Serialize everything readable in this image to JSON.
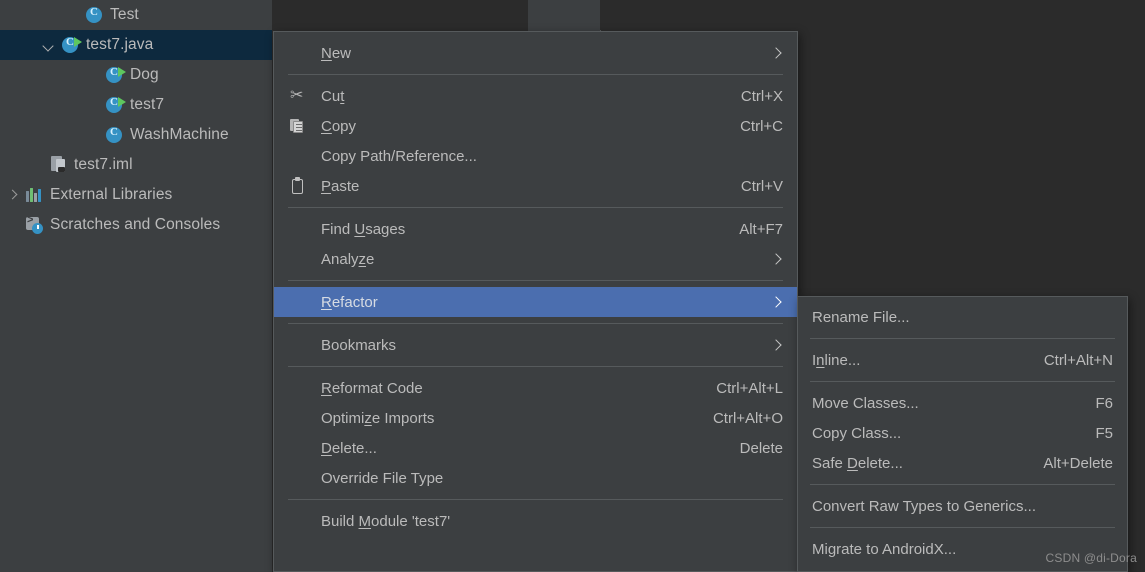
{
  "project_tree": {
    "items": [
      {
        "label": "Test",
        "icon": "java-class-icon",
        "indent": 84,
        "arrow": "none",
        "selected": false
      },
      {
        "label": "test7.java",
        "icon": "java-class-runnable-icon",
        "indent": 60,
        "arrow": "down",
        "selected": true
      },
      {
        "label": "Dog",
        "icon": "java-class-runnable-icon",
        "indent": 104,
        "arrow": "none",
        "selected": false
      },
      {
        "label": "test7",
        "icon": "java-class-runnable-icon",
        "indent": 104,
        "arrow": "none",
        "selected": false
      },
      {
        "label": "WashMachine",
        "icon": "java-class-icon",
        "indent": 104,
        "arrow": "none",
        "selected": false
      },
      {
        "label": "test7.iml",
        "icon": "module-file-icon",
        "indent": 48,
        "arrow": "none",
        "selected": false
      },
      {
        "label": "External Libraries",
        "icon": "libraries-icon",
        "indent": 24,
        "arrow": "right",
        "selected": false
      },
      {
        "label": "Scratches and Consoles",
        "icon": "scratches-icon",
        "indent": 24,
        "arrow": "none",
        "selected": false
      }
    ]
  },
  "context_menu": {
    "items": [
      {
        "type": "item",
        "name": "new",
        "label_pre": "",
        "label_mnemonic": "N",
        "label_post": "ew",
        "shortcut": "",
        "icon": "none",
        "submenu": true,
        "highlighted": false
      },
      {
        "type": "separator"
      },
      {
        "type": "item",
        "name": "cut",
        "label_pre": "Cu",
        "label_mnemonic": "t",
        "label_post": "",
        "shortcut": "Ctrl+X",
        "icon": "cut-icon",
        "submenu": false,
        "highlighted": false
      },
      {
        "type": "item",
        "name": "copy",
        "label_pre": "",
        "label_mnemonic": "C",
        "label_post": "opy",
        "shortcut": "Ctrl+C",
        "icon": "copy-icon",
        "submenu": false,
        "highlighted": false
      },
      {
        "type": "item",
        "name": "copy-path-reference",
        "label_pre": "Copy Path/Reference...",
        "label_mnemonic": "",
        "label_post": "",
        "shortcut": "",
        "icon": "none",
        "submenu": false,
        "highlighted": false
      },
      {
        "type": "item",
        "name": "paste",
        "label_pre": "",
        "label_mnemonic": "P",
        "label_post": "aste",
        "shortcut": "Ctrl+V",
        "icon": "paste-icon",
        "submenu": false,
        "highlighted": false
      },
      {
        "type": "separator"
      },
      {
        "type": "item",
        "name": "find-usages",
        "label_pre": "Find ",
        "label_mnemonic": "U",
        "label_post": "sages",
        "shortcut": "Alt+F7",
        "icon": "none",
        "submenu": false,
        "highlighted": false
      },
      {
        "type": "item",
        "name": "analyze",
        "label_pre": "Analy",
        "label_mnemonic": "z",
        "label_post": "e",
        "shortcut": "",
        "icon": "none",
        "submenu": true,
        "highlighted": false
      },
      {
        "type": "separator"
      },
      {
        "type": "item",
        "name": "refactor",
        "label_pre": "",
        "label_mnemonic": "R",
        "label_post": "efactor",
        "shortcut": "",
        "icon": "none",
        "submenu": true,
        "highlighted": true
      },
      {
        "type": "separator"
      },
      {
        "type": "item",
        "name": "bookmarks",
        "label_pre": "Bookmarks",
        "label_mnemonic": "",
        "label_post": "",
        "shortcut": "",
        "icon": "none",
        "submenu": true,
        "highlighted": false
      },
      {
        "type": "separator"
      },
      {
        "type": "item",
        "name": "reformat-code",
        "label_pre": "",
        "label_mnemonic": "R",
        "label_post": "eformat Code",
        "shortcut": "Ctrl+Alt+L",
        "icon": "none",
        "submenu": false,
        "highlighted": false
      },
      {
        "type": "item",
        "name": "optimize-imports",
        "label_pre": "Optimi",
        "label_mnemonic": "z",
        "label_post": "e Imports",
        "shortcut": "Ctrl+Alt+O",
        "icon": "none",
        "submenu": false,
        "highlighted": false
      },
      {
        "type": "item",
        "name": "delete",
        "label_pre": "",
        "label_mnemonic": "D",
        "label_post": "elete...",
        "shortcut": "Delete",
        "icon": "none",
        "submenu": false,
        "highlighted": false
      },
      {
        "type": "item",
        "name": "override-file-type",
        "label_pre": "Override File Type",
        "label_mnemonic": "",
        "label_post": "",
        "shortcut": "",
        "icon": "none",
        "submenu": false,
        "highlighted": false
      },
      {
        "type": "separator"
      },
      {
        "type": "item",
        "name": "build-module",
        "label_pre": "Build ",
        "label_mnemonic": "M",
        "label_post": "odule 'test7'",
        "shortcut": "",
        "icon": "none",
        "submenu": false,
        "highlighted": false
      }
    ]
  },
  "refactor_submenu": {
    "items": [
      {
        "type": "item",
        "name": "rename-file",
        "label_pre": "Rename File...",
        "label_mnemonic": "",
        "label_post": "",
        "shortcut": ""
      },
      {
        "type": "separator"
      },
      {
        "type": "item",
        "name": "inline",
        "label_pre": "I",
        "label_mnemonic": "n",
        "label_post": "line...",
        "shortcut": "Ctrl+Alt+N"
      },
      {
        "type": "separator"
      },
      {
        "type": "item",
        "name": "move-classes",
        "label_pre": "Move Classes...",
        "label_mnemonic": "",
        "label_post": "",
        "shortcut": "F6"
      },
      {
        "type": "item",
        "name": "copy-class",
        "label_pre": "Copy Class...",
        "label_mnemonic": "",
        "label_post": "",
        "shortcut": "F5"
      },
      {
        "type": "item",
        "name": "safe-delete",
        "label_pre": "Safe ",
        "label_mnemonic": "D",
        "label_post": "elete...",
        "shortcut": "Alt+Delete"
      },
      {
        "type": "separator"
      },
      {
        "type": "item",
        "name": "convert-raw-types-to-generics",
        "label_pre": "Convert Raw Types to Generics...",
        "label_mnemonic": "",
        "label_post": "",
        "shortcut": ""
      },
      {
        "type": "separator"
      },
      {
        "type": "item",
        "name": "migrate-to-androidx",
        "label_pre": "Migrate to AndroidX...",
        "label_mnemonic": "",
        "label_post": "",
        "shortcut": ""
      }
    ]
  },
  "watermark": {
    "text": "CSDN @di-Dora"
  },
  "colors": {
    "menu_background": "#3c3f41",
    "editor_background": "#2b2b2b",
    "menu_border": "#565a5c",
    "highlight_blue": "#4b6eaf",
    "tree_selection": "#0d293e",
    "text": "#bbbbbb",
    "class_icon": "#3592c4",
    "run_marker_green": "#5ec75e"
  }
}
